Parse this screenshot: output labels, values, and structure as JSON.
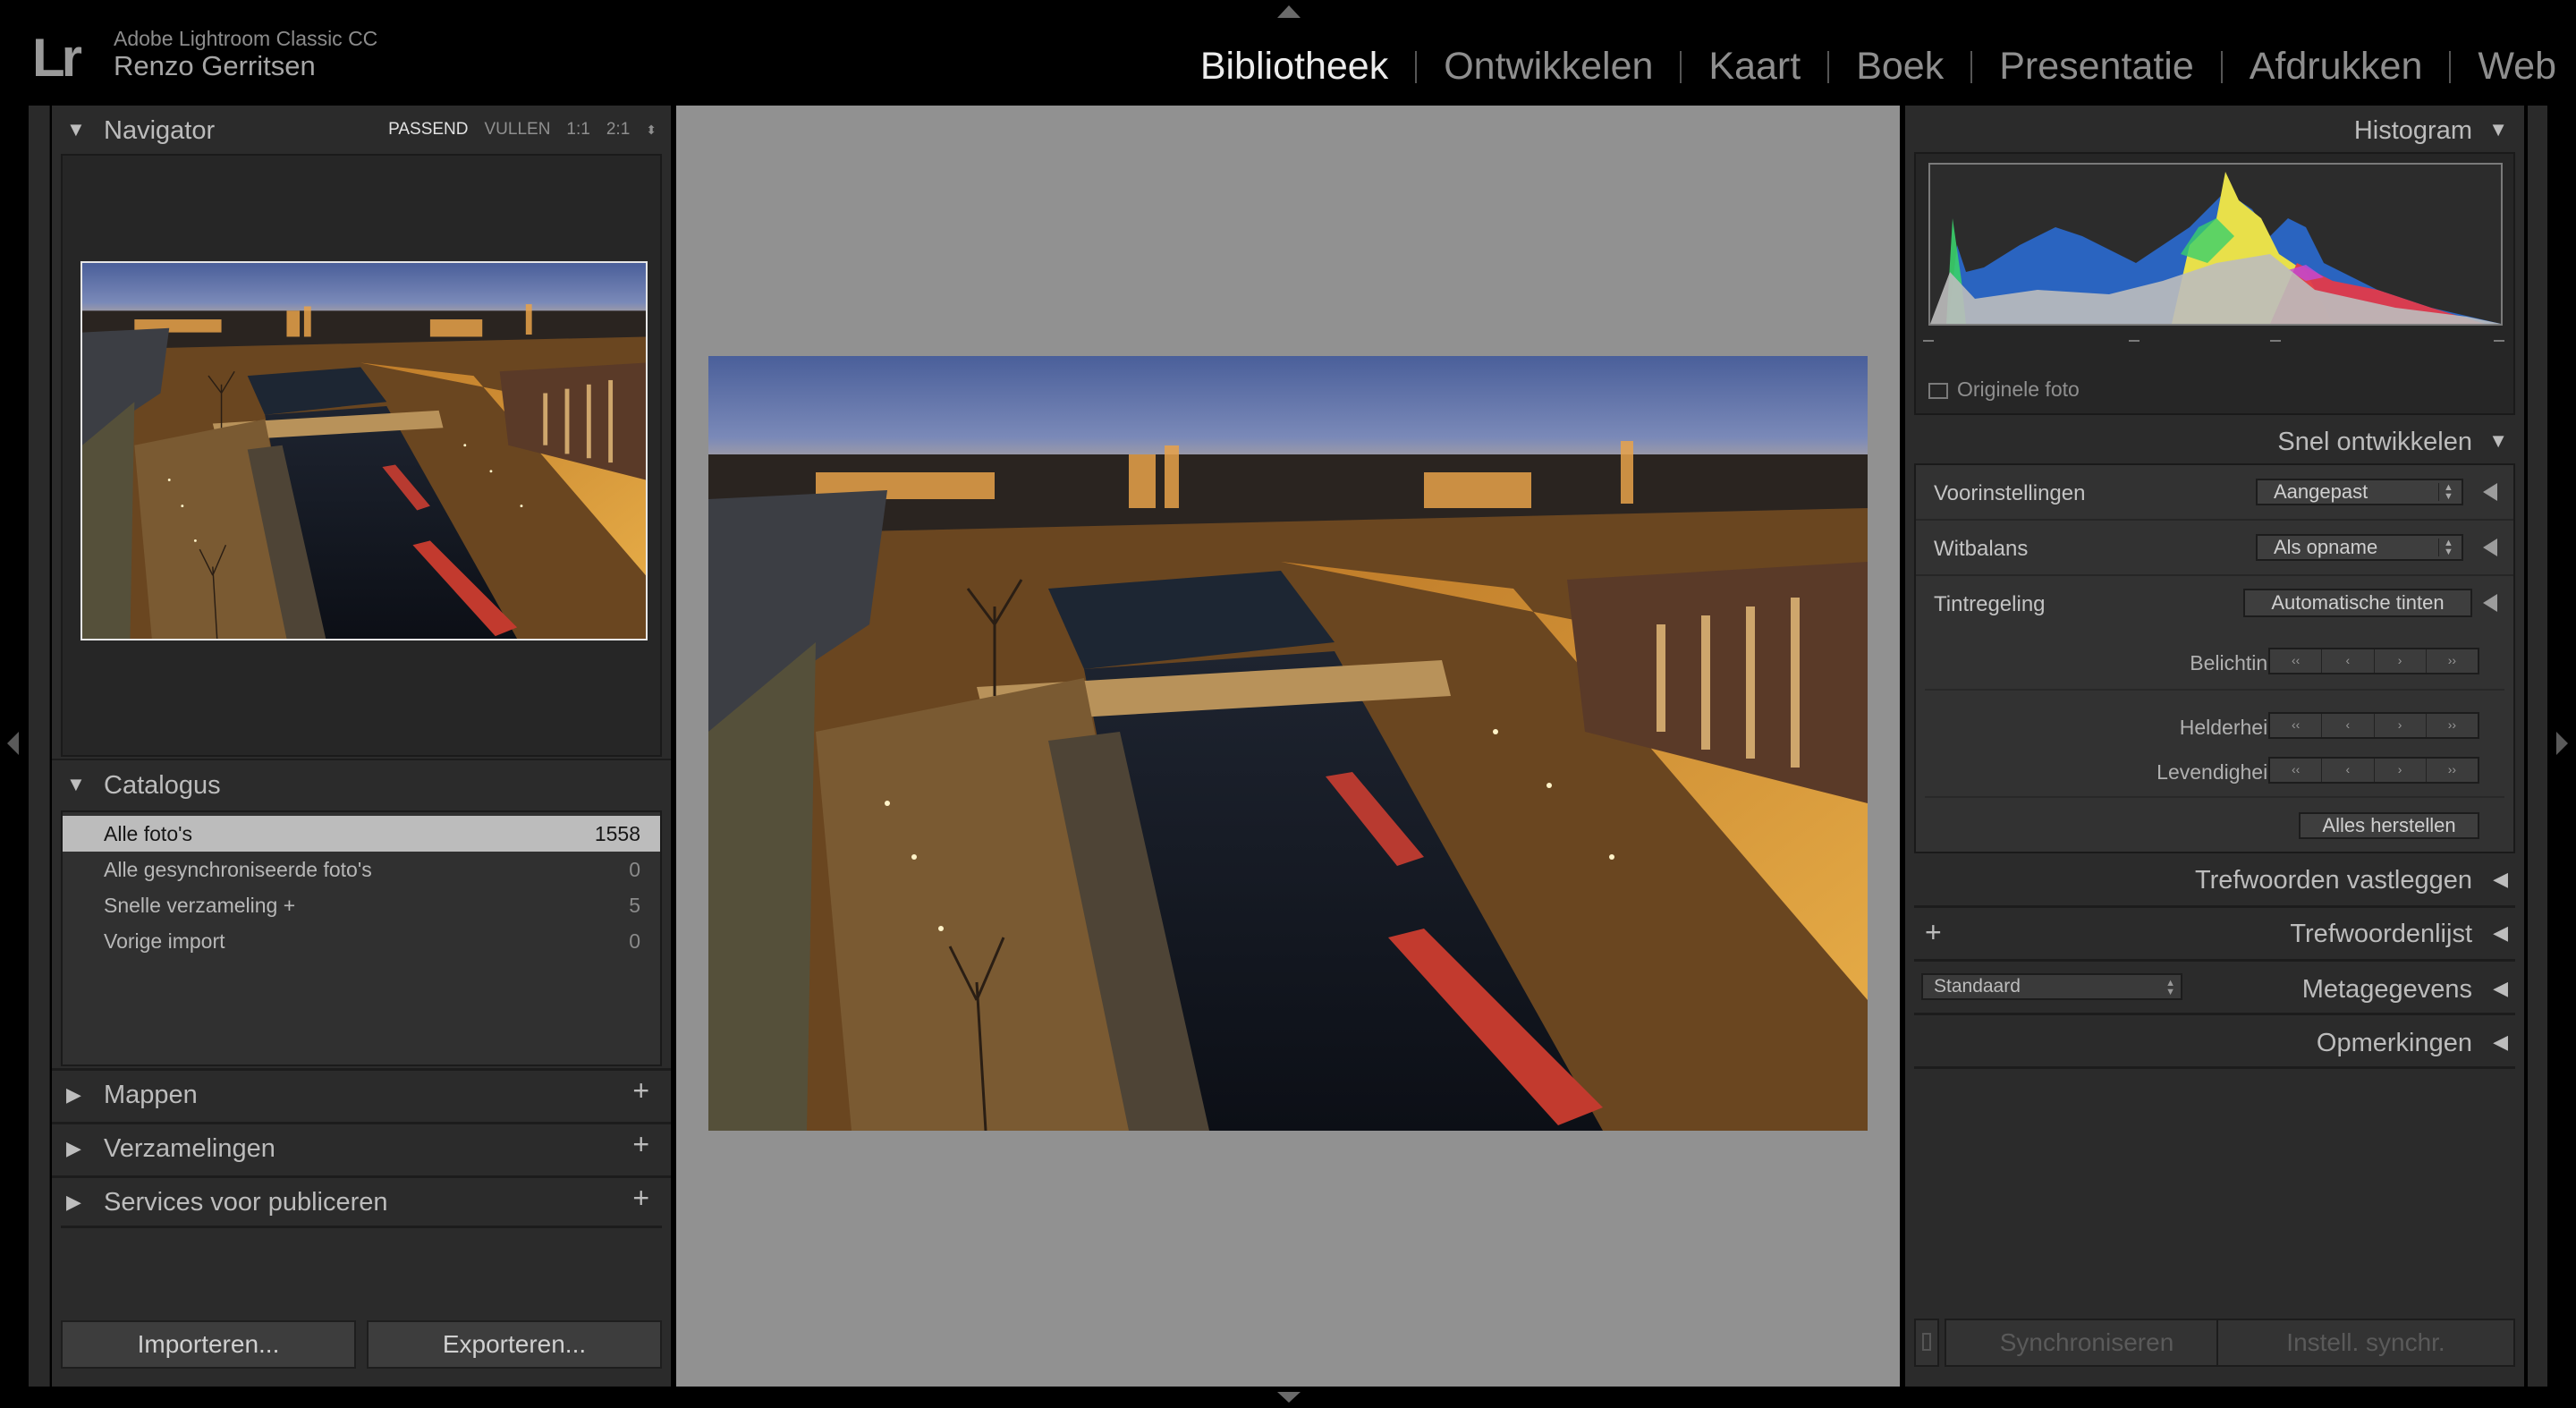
{
  "app": {
    "logo": "Lr",
    "product": "Adobe Lightroom Classic CC",
    "user": "Renzo Gerritsen"
  },
  "modules": [
    {
      "label": "Bibliotheek",
      "active": true
    },
    {
      "label": "Ontwikkelen",
      "active": false
    },
    {
      "label": "Kaart",
      "active": false
    },
    {
      "label": "Boek",
      "active": false
    },
    {
      "label": "Presentatie",
      "active": false
    },
    {
      "label": "Afdrukken",
      "active": false
    },
    {
      "label": "Web",
      "active": false
    }
  ],
  "navigator": {
    "title": "Navigator",
    "zoom": {
      "fit": "PASSEND",
      "fill": "VULLEN",
      "one": "1:1",
      "two": "2:1"
    }
  },
  "catalog": {
    "title": "Catalogus",
    "rows": [
      {
        "label": "Alle foto's",
        "count": "1558"
      },
      {
        "label": "Alle gesynchroniseerde foto's",
        "count": "0"
      },
      {
        "label": "Snelle verzameling +",
        "count": "5"
      },
      {
        "label": "Vorige import",
        "count": "0"
      }
    ]
  },
  "left_sections": {
    "folders": "Mappen",
    "collections": "Verzamelingen",
    "publish": "Services voor publiceren"
  },
  "left_buttons": {
    "import": "Importeren...",
    "export": "Exporteren..."
  },
  "histogram": {
    "title": "Histogram",
    "original_photo": "Originele foto"
  },
  "quick_develop": {
    "title": "Snel ontwikkelen",
    "presets_label": "Voorinstellingen",
    "presets_value": "Aangepast",
    "wb_label": "Witbalans",
    "wb_value": "Als opname",
    "tone_label": "Tintregeling",
    "auto_tone": "Automatische tinten",
    "exposure": "Belichting",
    "clarity": "Helderheid",
    "vibrance": "Levendigheid",
    "step_labels": [
      "‹‹",
      "‹",
      "›",
      "››"
    ],
    "reset_all": "Alles herstellen"
  },
  "right_sections": {
    "keywording": "Trefwoorden vastleggen",
    "keyword_list": "Trefwoordenlijst",
    "metadata": "Metagegevens",
    "metadata_preset": "Standaard",
    "comments": "Opmerkingen"
  },
  "right_buttons": {
    "sync": "Synchroniseren",
    "sync_settings": "Instell. synchr."
  },
  "colors": {
    "panel_bg": "#2b2b2b",
    "view_bg": "#919191",
    "active_module": "#ececec",
    "selected_row": "#bcbcbc"
  }
}
